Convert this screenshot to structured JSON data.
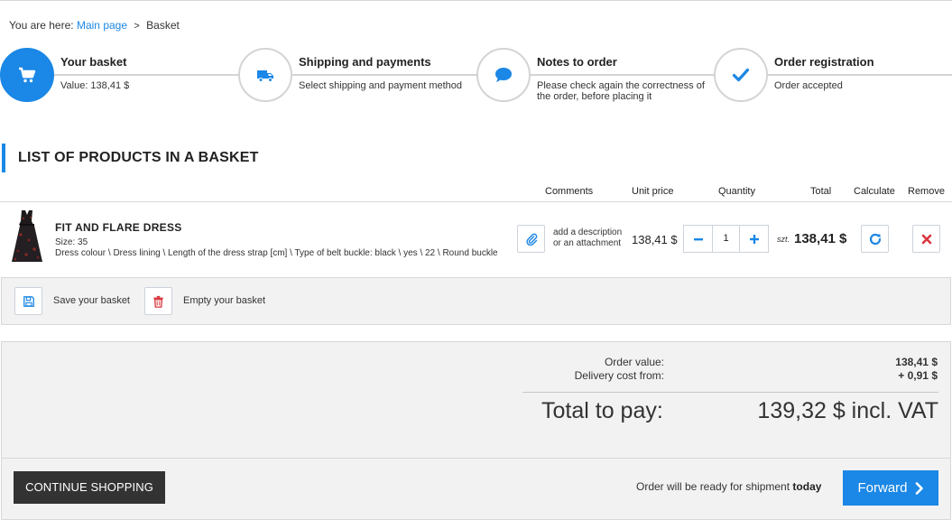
{
  "breadcrumb": {
    "prefix": "You are here:",
    "home": "Main page",
    "separator": ">",
    "current": "Basket"
  },
  "steps": [
    {
      "title": "Your basket",
      "desc": "Value: 138,41 $",
      "icon": "cart-icon",
      "active": true
    },
    {
      "title": "Shipping and payments",
      "desc": "Select shipping and payment method",
      "icon": "truck-icon",
      "active": false
    },
    {
      "title": "Notes to order",
      "desc": "Please check again the correctness of the order, before placing it",
      "icon": "speech-bubble-icon",
      "active": false
    },
    {
      "title": "Order registration",
      "desc": "Order accepted",
      "icon": "checkmark-icon",
      "active": false
    }
  ],
  "list_title": "LIST OF PRODUCTS IN A BASKET",
  "columns": {
    "comments": "Comments",
    "unit_price": "Unit price",
    "quantity": "Quantity",
    "total": "Total",
    "calculate": "Calculate",
    "remove": "Remove"
  },
  "product": {
    "name": "FIT AND FLARE DRESS",
    "size": "Size: 35",
    "attributes": "Dress colour \\ Dress lining \\ Length of the dress strap [cm] \\ Type of belt buckle: black \\ yes \\ 22 \\ Round buckle",
    "comment_line1": "add a description",
    "comment_line2": "or an attachment",
    "unit_price": "138,41 $",
    "quantity": "1",
    "unit": "szt.",
    "total": "138,41 $"
  },
  "actions": {
    "save": "Save your basket",
    "empty": "Empty your basket"
  },
  "summary": {
    "order_value_label": "Order value:",
    "order_value": "138,41 $",
    "delivery_label": "Delivery cost from:",
    "delivery_value": "+ 0,91 $",
    "total_label": "Total to pay:",
    "total_value": "139,32 $ incl. VAT"
  },
  "footer": {
    "continue_label": "CONTINUE SHOPPING",
    "ready_text": "Order will be ready for shipment",
    "ready_when": "today",
    "forward_label": "Forward"
  },
  "colors": {
    "accent": "#1b87e6",
    "remove": "#d9363e",
    "dark_button": "#333333",
    "panel": "#f2f2f2"
  }
}
